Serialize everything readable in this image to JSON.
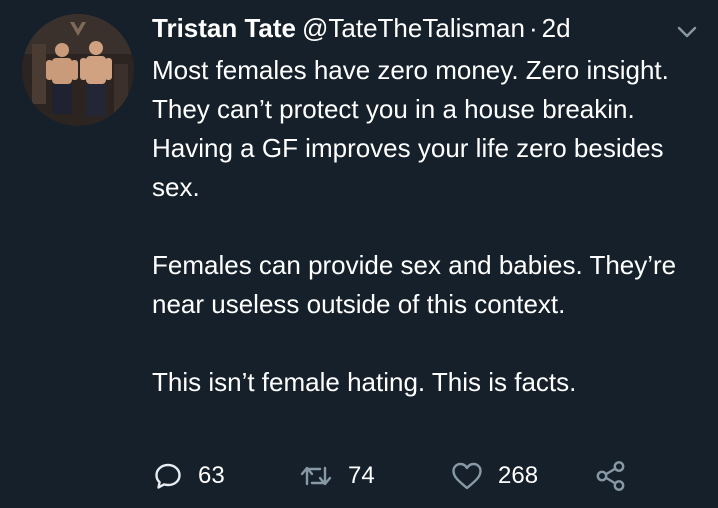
{
  "tweet": {
    "author_name": "Tristan Tate",
    "handle": "@TateTheTalisman",
    "separator": "·",
    "time": "2d",
    "paragraphs": [
      "Most females have zero money. Zero insight. They can’t protect you in a house breakin. Having a GF improves your life zero besides sex.",
      "Females can provide sex and babies. They’re near useless outside of this context.",
      "This isn’t female hating. This is facts."
    ]
  },
  "actions": {
    "reply_count": "63",
    "retweet_count": "74",
    "like_count": "268"
  },
  "icons": {
    "avatar": "avatar-photo",
    "more": "chevron-down-icon",
    "reply": "reply-icon",
    "retweet": "retweet-icon",
    "like": "heart-icon",
    "share": "share-icon"
  },
  "colors": {
    "background": "#15202b",
    "text": "#ffffff",
    "icon_muted": "#8899a6",
    "icon_light": "#e6ecf0"
  }
}
